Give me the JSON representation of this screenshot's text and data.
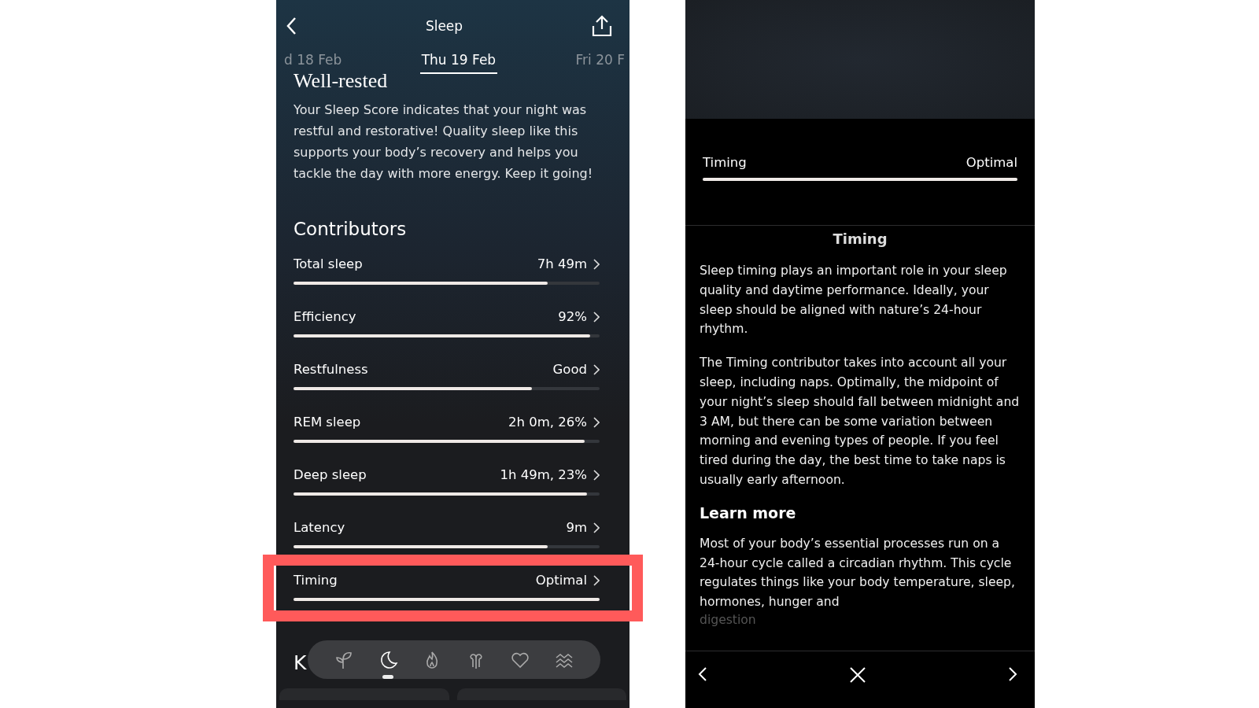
{
  "left_screen": {
    "title": "Sleep",
    "dates": [
      {
        "label": "d 18 Feb",
        "selected": false
      },
      {
        "label": "Thu 19 Feb",
        "selected": true
      },
      {
        "label": "Fri 20 F",
        "selected": false
      }
    ],
    "heading": "Well-rested",
    "summary": "Your Sleep Score indicates that your night was restful and restorative! Quality sleep like this supports your body’s recovery and helps you tackle the day with more energy. Keep it going!",
    "contributors_title": "Contributors",
    "contributors": [
      {
        "name": "Total sleep",
        "value": "7h 49m",
        "level": 0.83,
        "highlighted": false
      },
      {
        "name": "Efficiency",
        "value": "92%",
        "level": 0.97,
        "highlighted": false
      },
      {
        "name": "Restfulness",
        "value": "Good",
        "level": 0.78,
        "highlighted": false
      },
      {
        "name": "REM sleep",
        "value": "2h 0m, 26%",
        "level": 0.95,
        "highlighted": false
      },
      {
        "name": "Deep sleep",
        "value": "1h 49m, 23%",
        "level": 0.96,
        "highlighted": false
      },
      {
        "name": "Latency",
        "value": "9m",
        "level": 0.83,
        "highlighted": false
      },
      {
        "name": "Timing",
        "value": "Optimal",
        "level": 1,
        "highlighted": true
      }
    ],
    "next_section_title": "K",
    "nav": [
      {
        "selected": false
      },
      {
        "selected": true
      },
      {
        "selected": false
      },
      {
        "selected": false
      },
      {
        "selected": false
      },
      {
        "selected": false
      }
    ]
  },
  "right_screen": {
    "contributor": {
      "name": "Timing",
      "value": "Optimal",
      "level": 1
    },
    "title": "Timing",
    "paragraphs": [
      "Sleep timing plays an important role in your sleep quality and daytime performance. Ideally, your sleep should be aligned with nature’s 24-hour rhythm.",
      "The Timing contributor takes into account all your sleep, including naps. Optimally, the midpoint of your night’s sleep should fall between midnight and 3 AM, but there can be some variation between morning and evening types of people. If you feel tired during the day, the best time to take naps is usually early afternoon."
    ],
    "learn_more_title": "Learn more",
    "learn_more_text": "Most of your body’s essential processes run on a 24-hour cycle called a circadian rhythm. This cycle regulates things like your body temperature, sleep, hormones, hunger and",
    "learn_more_cut": "digestion"
  }
}
